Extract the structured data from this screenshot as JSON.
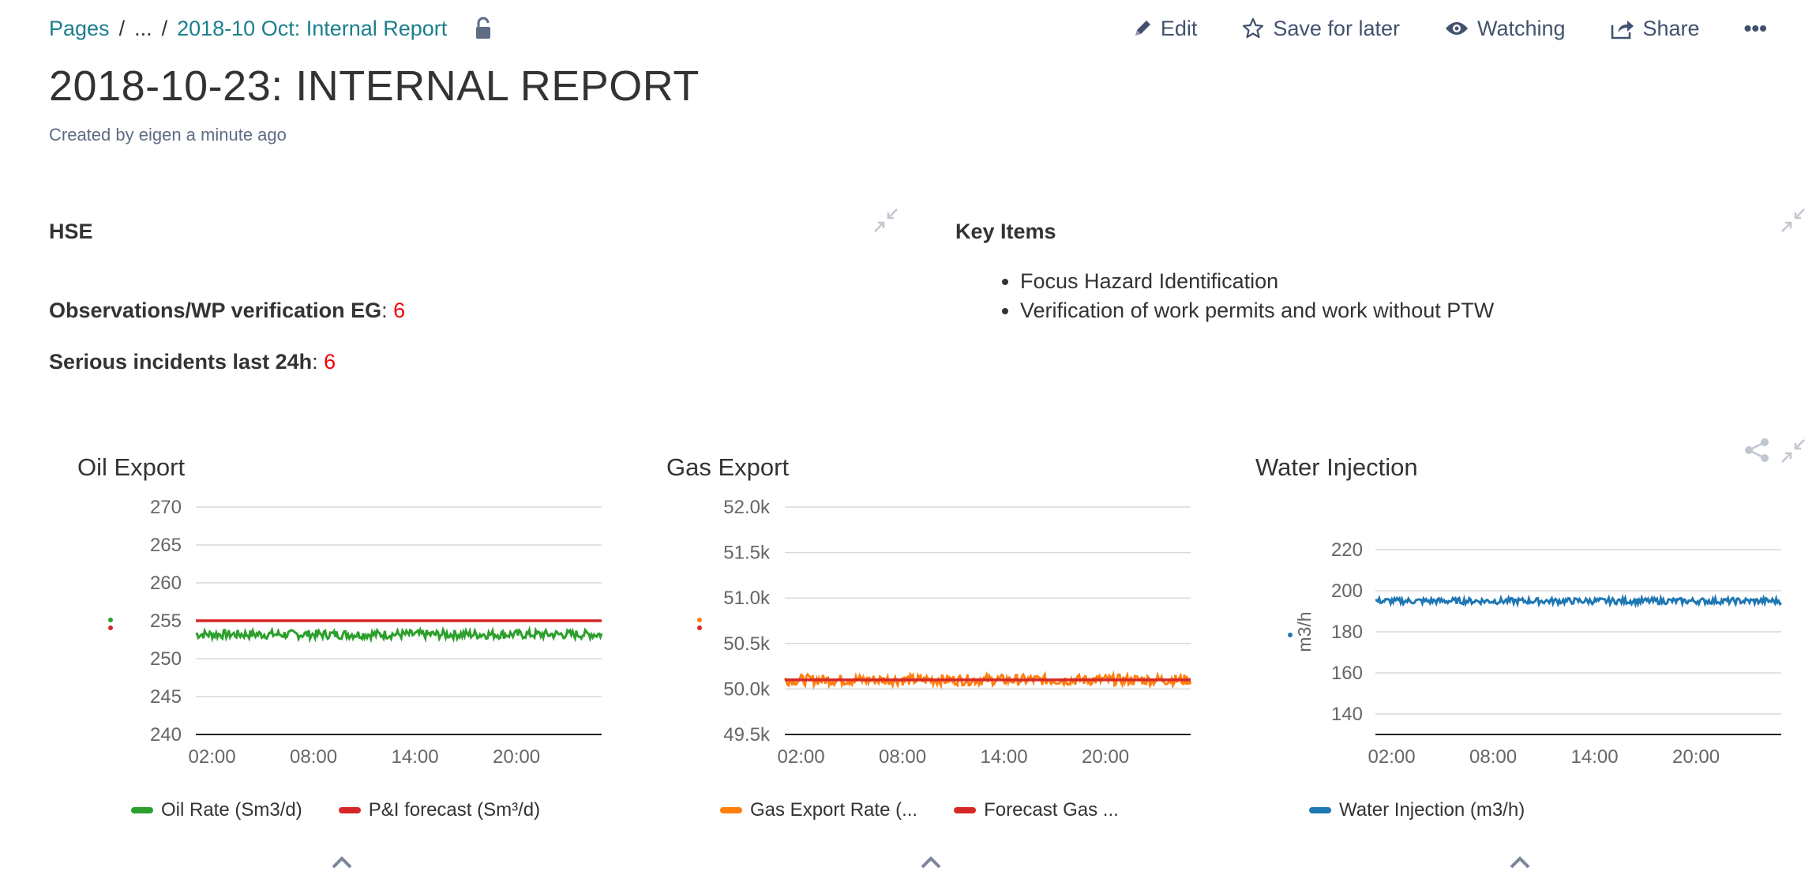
{
  "breadcrumb": {
    "root": "Pages",
    "sep1": "/",
    "ellipsis": "...",
    "sep2": "/",
    "current": "2018-10 Oct: Internal Report"
  },
  "actions": {
    "edit": "Edit",
    "save": "Save for later",
    "watch": "Watching",
    "share": "Share",
    "more": "•••"
  },
  "page": {
    "title": "2018-10-23: INTERNAL REPORT",
    "byline": "Created by eigen a minute ago"
  },
  "hse": {
    "title": "HSE",
    "obs_label": "Observations/WP verification EG",
    "obs_value": "6",
    "incidents_label": "Serious incidents last 24h",
    "incidents_value": "6",
    "colon": ":"
  },
  "key_items": {
    "title": "Key Items",
    "items": [
      "Focus Hazard Identification",
      "Verification of work permits and work without PTW"
    ]
  },
  "icons": {
    "lock": "unlock-icon",
    "edit": "pencil-icon",
    "save": "star-icon",
    "watch": "eye-icon",
    "share": "share-icon",
    "collapse": "collapse-icon",
    "caret": "chevron-up-icon"
  },
  "colors": {
    "oil": "#2ca02c",
    "forecast": "#d62728",
    "gas": "#ff7f0e",
    "water": "#1f77b4",
    "accent": "#1a7f8e",
    "value_red": "#ee0000"
  },
  "chart_data": [
    {
      "type": "line",
      "title": "Oil Export",
      "ylabel": "",
      "ylim": [
        240,
        270
      ],
      "yticks": [
        "270",
        "265",
        "260",
        "255",
        "250",
        "245",
        "240"
      ],
      "xticks": [
        "02:00",
        "08:00",
        "14:00",
        "20:00"
      ],
      "series": [
        {
          "name": "Oil Rate (Sm3/d)",
          "value": 253.2,
          "noise": 0.6,
          "color": "#2ca02c"
        },
        {
          "name": "P&I forecast (Sm³/d)",
          "value": 255,
          "noise": 0,
          "color": "#d62728"
        }
      ]
    },
    {
      "type": "line",
      "title": "Gas Export",
      "ylabel": "",
      "ylim": [
        49500,
        52000
      ],
      "yticks": [
        "52.0k",
        "51.5k",
        "51.0k",
        "50.5k",
        "50.0k",
        "49.5k"
      ],
      "xticks": [
        "02:00",
        "08:00",
        "14:00",
        "20:00"
      ],
      "series": [
        {
          "name": "Gas Export Rate (...",
          "value": 50100,
          "noise": 60,
          "color": "#ff7f0e"
        },
        {
          "name": "Forecast Gas ...",
          "value": 50100,
          "noise": 0,
          "color": "#d62728"
        }
      ]
    },
    {
      "type": "line",
      "title": "Water Injection",
      "ylabel": "m3/h",
      "ylim": [
        130,
        230
      ],
      "yticks": [
        "220",
        "200",
        "180",
        "160",
        "140"
      ],
      "xticks": [
        "02:00",
        "08:00",
        "14:00",
        "20:00"
      ],
      "series": [
        {
          "name": "Water Injection (m3/h)",
          "value": 195,
          "noise": 1.5,
          "color": "#1f77b4"
        }
      ]
    }
  ]
}
